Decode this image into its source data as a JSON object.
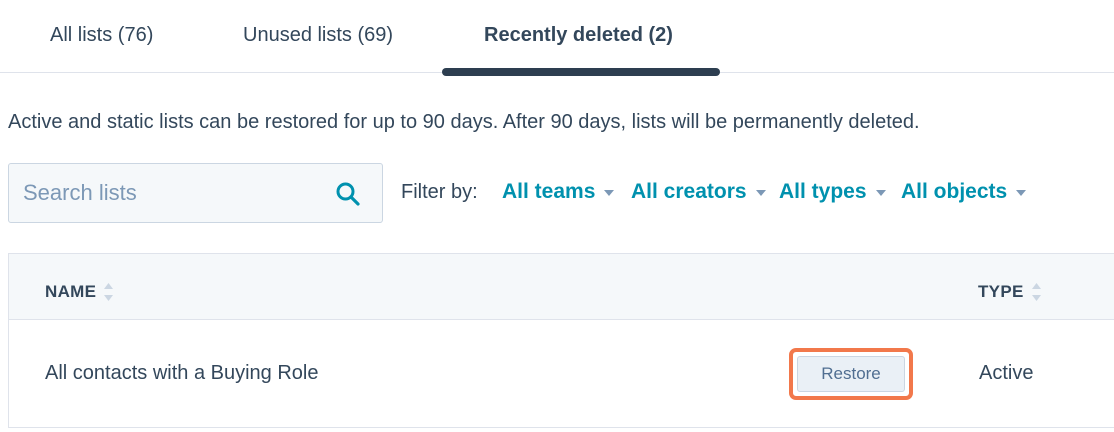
{
  "tabs": [
    {
      "label": "All lists (76)",
      "active": false
    },
    {
      "label": "Unused lists (69)",
      "active": false
    },
    {
      "label": "Recently deleted (2)",
      "active": true
    }
  ],
  "notice": "Active and static lists can be restored for up to 90 days. After 90 days, lists will be permanently deleted.",
  "search": {
    "placeholder": "Search lists",
    "value": "",
    "icon": "search-icon"
  },
  "filters": {
    "label": "Filter by:",
    "items": [
      "All teams",
      "All creators",
      "All types",
      "All objects"
    ]
  },
  "table": {
    "columns": {
      "name": "NAME",
      "type": "TYPE"
    },
    "rows": [
      {
        "name": "All contacts with a Buying Role",
        "action": "Restore",
        "type": "Active"
      }
    ]
  },
  "colors": {
    "text": "#33475b",
    "link": "#0091ae",
    "tab_indicator": "#2d3e50",
    "highlight": "#f2784b",
    "header_bg": "#f5f8fa"
  }
}
